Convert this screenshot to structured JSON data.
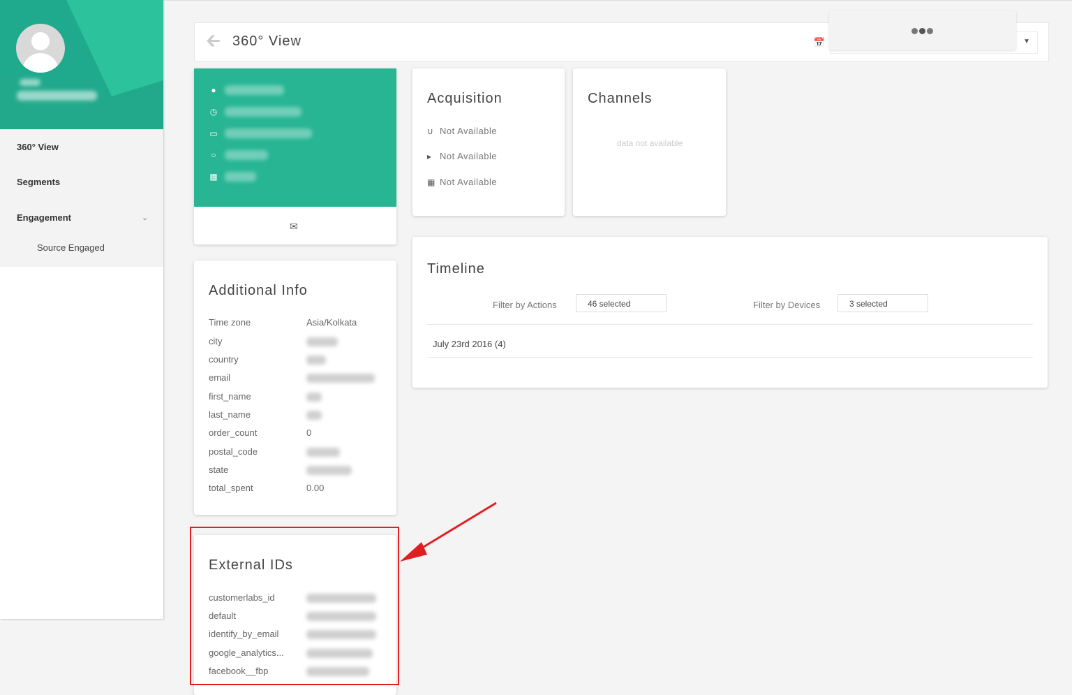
{
  "sidebar": {
    "items": [
      {
        "label": "360° View"
      },
      {
        "label": "Segments"
      },
      {
        "label": "Engagement"
      }
    ],
    "subitems": [
      {
        "label": "Source Engaged"
      }
    ]
  },
  "header": {
    "title": "360° View",
    "back_icon": "arrow-left-icon",
    "calendar_icon": "calendar-icon"
  },
  "profile": {
    "icons": [
      "map-marker-icon",
      "clock-icon",
      "desktop-icon",
      "circle-icon",
      "windows-icon"
    ],
    "contact_icon": "envelope-icon"
  },
  "acquisition": {
    "title": "Acquisition",
    "rows": [
      {
        "icon": "magnet-icon",
        "text": "Not Available"
      },
      {
        "icon": "bullhorn-icon",
        "text": "Not Available"
      },
      {
        "icon": "calendar-icon",
        "text": "Not Available"
      }
    ]
  },
  "channels": {
    "title": "Channels",
    "empty_text": "data not available"
  },
  "additional_info": {
    "title": "Additional Info",
    "rows": [
      {
        "label": "Time zone",
        "value": "Asia/Kolkata"
      },
      {
        "label": "city",
        "value": ""
      },
      {
        "label": "country",
        "value": ""
      },
      {
        "label": "email",
        "value": ""
      },
      {
        "label": "first_name",
        "value": ""
      },
      {
        "label": "last_name",
        "value": ""
      },
      {
        "label": "order_count",
        "value": "0"
      },
      {
        "label": "postal_code",
        "value": ""
      },
      {
        "label": "state",
        "value": ""
      },
      {
        "label": "total_spent",
        "value": "0.00"
      }
    ]
  },
  "external_ids": {
    "title": "External IDs",
    "rows": [
      {
        "label": "customerlabs_id"
      },
      {
        "label": "default"
      },
      {
        "label": "identify_by_email"
      },
      {
        "label": "google_analytics..."
      },
      {
        "label": "facebook__fbp"
      }
    ]
  },
  "timeline": {
    "title": "Timeline",
    "filter_actions_label": "Filter by Actions",
    "filter_actions_value": "46 selected",
    "filter_devices_label": "Filter by Devices",
    "filter_devices_value": "3 selected",
    "date_group": "July 23rd 2016 (4)"
  },
  "colors": {
    "accent": "#27b594",
    "highlight": "#e02020"
  }
}
